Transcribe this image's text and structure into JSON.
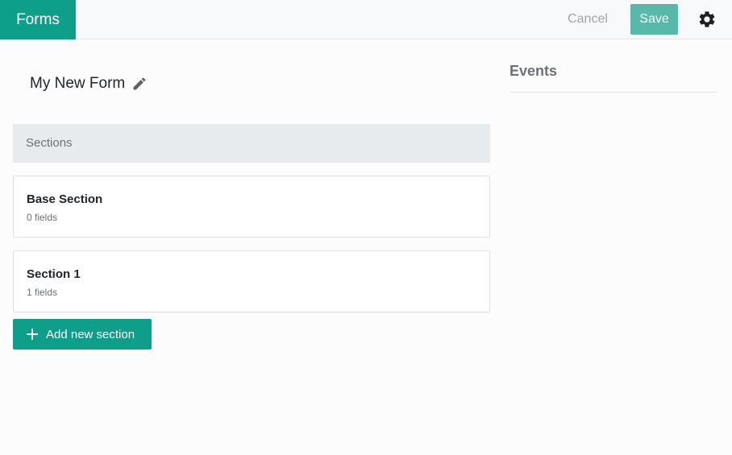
{
  "header": {
    "brand_label": "Forms",
    "cancel_label": "Cancel",
    "save_label": "Save",
    "settings_icon": "gear-icon"
  },
  "form": {
    "title": "My New Form",
    "edit_icon": "pencil-icon"
  },
  "sections": {
    "header_label": "Sections",
    "items": [
      {
        "name": "Base Section",
        "count": "0 fields"
      },
      {
        "name": "Section 1",
        "count": "1 fields"
      }
    ],
    "add_label": "Add new section"
  },
  "events": {
    "title": "Events"
  },
  "colors": {
    "accent": "#0e9f8a",
    "save_button": "#58b9aa",
    "sections_header_bg": "#e8ebee"
  }
}
